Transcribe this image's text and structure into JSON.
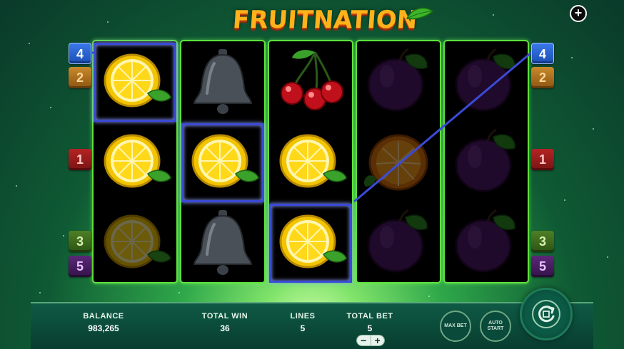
{
  "header": {
    "logo_text": "FRUITNATION",
    "plus_label": "+"
  },
  "reels": [
    [
      "lemon",
      "lemon",
      "lemon"
    ],
    [
      "bell",
      "lemon",
      "bell"
    ],
    [
      "cherries",
      "lemon",
      "lemon"
    ],
    [
      "plum",
      "orange",
      "plum"
    ],
    [
      "plum",
      "plum",
      "plum"
    ]
  ],
  "left_line_badges": [
    "4",
    "2",
    "1",
    "3",
    "5"
  ],
  "right_line_badges": [
    "4",
    "2",
    "1",
    "3",
    "5"
  ],
  "bottom_bar": {
    "balance_label": "BALANCE",
    "balance_value": "983,265",
    "total_win_label": "TOTAL WIN",
    "total_win_value": "36",
    "lines_label": "LINES",
    "lines_value": "5",
    "total_bet_label": "TOTAL BET",
    "total_bet_value": "5",
    "minus_label": "−",
    "plus_label": "+",
    "max_bet_label": "MAX BET",
    "auto_start_label": "AUTO START"
  },
  "colors": {
    "reel_border": "#5ee13d",
    "payline": "#3b4ad6",
    "bar_bg": "#0f5a45"
  }
}
